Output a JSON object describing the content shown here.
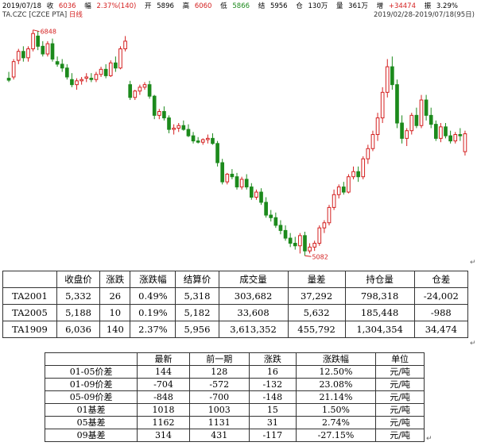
{
  "header": {
    "date": "2019/07/18",
    "close_label": "收",
    "close": "6036",
    "change_label": "幅",
    "change": "2.37%(140)",
    "open_label": "开",
    "open": "5896",
    "high_label": "高",
    "high": "6060",
    "low_label": "低",
    "low": "5866",
    "settle_label": "结",
    "settle": "5956",
    "oi_label": "仓",
    "oi": "130万",
    "vol_label": "量",
    "vol": "361万",
    "oi_chg_label": "增",
    "oi_chg": "+34474",
    "amp_label": "振",
    "amp": "3.29%",
    "symbol": "TA.CZC [CZCE PTA]",
    "mode": "日线",
    "range": "2019/02/28-2019/07/18(95日)"
  },
  "colors": {
    "up": "#d42020",
    "down": "#1c8a1c",
    "marker": "#d42020"
  },
  "chart_data": {
    "type": "candlestick",
    "title": "",
    "annotations": [
      {
        "text": "6848",
        "at": "high"
      },
      {
        "text": "5082",
        "at": "low"
      }
    ],
    "candles": [
      {
        "o": 6470,
        "h": 6520,
        "l": 6440,
        "c": 6455
      },
      {
        "o": 6480,
        "h": 6620,
        "l": 6460,
        "c": 6600
      },
      {
        "o": 6610,
        "h": 6700,
        "l": 6580,
        "c": 6680
      },
      {
        "o": 6680,
        "h": 6720,
        "l": 6600,
        "c": 6630
      },
      {
        "o": 6630,
        "h": 6720,
        "l": 6600,
        "c": 6700
      },
      {
        "o": 6700,
        "h": 6848,
        "l": 6680,
        "c": 6820
      },
      {
        "o": 6800,
        "h": 6840,
        "l": 6690,
        "c": 6720
      },
      {
        "o": 6720,
        "h": 6760,
        "l": 6640,
        "c": 6660
      },
      {
        "o": 6660,
        "h": 6760,
        "l": 6640,
        "c": 6740
      },
      {
        "o": 6740,
        "h": 6780,
        "l": 6600,
        "c": 6620
      },
      {
        "o": 6600,
        "h": 6640,
        "l": 6560,
        "c": 6580
      },
      {
        "o": 6580,
        "h": 6620,
        "l": 6520,
        "c": 6550
      },
      {
        "o": 6550,
        "h": 6580,
        "l": 6460,
        "c": 6480
      },
      {
        "o": 6460,
        "h": 6510,
        "l": 6400,
        "c": 6420
      },
      {
        "o": 6420,
        "h": 6470,
        "l": 6380,
        "c": 6450
      },
      {
        "o": 6450,
        "h": 6480,
        "l": 6420,
        "c": 6460
      },
      {
        "o": 6470,
        "h": 6510,
        "l": 6440,
        "c": 6480
      },
      {
        "o": 6470,
        "h": 6510,
        "l": 6440,
        "c": 6460
      },
      {
        "o": 6460,
        "h": 6520,
        "l": 6440,
        "c": 6500
      },
      {
        "o": 6500,
        "h": 6560,
        "l": 6480,
        "c": 6540
      },
      {
        "o": 6540,
        "h": 6580,
        "l": 6470,
        "c": 6490
      },
      {
        "o": 6490,
        "h": 6610,
        "l": 6480,
        "c": 6590
      },
      {
        "o": 6590,
        "h": 6640,
        "l": 6520,
        "c": 6550
      },
      {
        "o": 6550,
        "h": 6720,
        "l": 6540,
        "c": 6700
      },
      {
        "o": 6700,
        "h": 6800,
        "l": 6680,
        "c": 6760
      },
      {
        "o": 6420,
        "h": 6450,
        "l": 6300,
        "c": 6320
      },
      {
        "o": 6320,
        "h": 6380,
        "l": 6300,
        "c": 6370
      },
      {
        "o": 6370,
        "h": 6420,
        "l": 6340,
        "c": 6400
      },
      {
        "o": 6400,
        "h": 6440,
        "l": 6380,
        "c": 6420
      },
      {
        "o": 6420,
        "h": 6450,
        "l": 6310,
        "c": 6330
      },
      {
        "o": 6330,
        "h": 6340,
        "l": 6150,
        "c": 6180
      },
      {
        "o": 6180,
        "h": 6230,
        "l": 6150,
        "c": 6210
      },
      {
        "o": 6210,
        "h": 6250,
        "l": 6140,
        "c": 6160
      },
      {
        "o": 6160,
        "h": 6180,
        "l": 6040,
        "c": 6070
      },
      {
        "o": 6070,
        "h": 6110,
        "l": 6030,
        "c": 6080
      },
      {
        "o": 6080,
        "h": 6120,
        "l": 6050,
        "c": 6100
      },
      {
        "o": 6100,
        "h": 6140,
        "l": 6060,
        "c": 6070
      },
      {
        "o": 6070,
        "h": 6110,
        "l": 6010,
        "c": 6020
      },
      {
        "o": 6020,
        "h": 6050,
        "l": 5960,
        "c": 5980
      },
      {
        "o": 5980,
        "h": 6010,
        "l": 5960,
        "c": 5970
      },
      {
        "o": 5970,
        "h": 6000,
        "l": 5950,
        "c": 5990
      },
      {
        "o": 5990,
        "h": 6030,
        "l": 5960,
        "c": 6000
      },
      {
        "o": 6000,
        "h": 6040,
        "l": 5950,
        "c": 5960
      },
      {
        "o": 5960,
        "h": 5980,
        "l": 5780,
        "c": 5810
      },
      {
        "o": 5810,
        "h": 5840,
        "l": 5640,
        "c": 5660
      },
      {
        "o": 5660,
        "h": 5730,
        "l": 5640,
        "c": 5720
      },
      {
        "o": 5720,
        "h": 5760,
        "l": 5680,
        "c": 5700
      },
      {
        "o": 5700,
        "h": 5730,
        "l": 5600,
        "c": 5620
      },
      {
        "o": 5620,
        "h": 5700,
        "l": 5600,
        "c": 5680
      },
      {
        "o": 5680,
        "h": 5720,
        "l": 5600,
        "c": 5620
      },
      {
        "o": 5620,
        "h": 5650,
        "l": 5520,
        "c": 5540
      },
      {
        "o": 5540,
        "h": 5600,
        "l": 5520,
        "c": 5580
      },
      {
        "o": 5580,
        "h": 5610,
        "l": 5480,
        "c": 5500
      },
      {
        "o": 5500,
        "h": 5540,
        "l": 5380,
        "c": 5400
      },
      {
        "o": 5400,
        "h": 5440,
        "l": 5350,
        "c": 5380
      },
      {
        "o": 5380,
        "h": 5420,
        "l": 5300,
        "c": 5320
      },
      {
        "o": 5320,
        "h": 5360,
        "l": 5250,
        "c": 5280
      },
      {
        "o": 5280,
        "h": 5320,
        "l": 5200,
        "c": 5220
      },
      {
        "o": 5220,
        "h": 5260,
        "l": 5150,
        "c": 5180
      },
      {
        "o": 5180,
        "h": 5230,
        "l": 5130,
        "c": 5160
      },
      {
        "o": 5160,
        "h": 5260,
        "l": 5100,
        "c": 5240
      },
      {
        "o": 5240,
        "h": 5270,
        "l": 5082,
        "c": 5120
      },
      {
        "o": 5120,
        "h": 5180,
        "l": 5100,
        "c": 5150
      },
      {
        "o": 5150,
        "h": 5200,
        "l": 5120,
        "c": 5180
      },
      {
        "o": 5180,
        "h": 5320,
        "l": 5160,
        "c": 5300
      },
      {
        "o": 5300,
        "h": 5360,
        "l": 5260,
        "c": 5340
      },
      {
        "o": 5340,
        "h": 5480,
        "l": 5320,
        "c": 5460
      },
      {
        "o": 5460,
        "h": 5600,
        "l": 5440,
        "c": 5560
      },
      {
        "o": 5560,
        "h": 5640,
        "l": 5530,
        "c": 5620
      },
      {
        "o": 5620,
        "h": 5660,
        "l": 5560,
        "c": 5580
      },
      {
        "o": 5580,
        "h": 5720,
        "l": 5570,
        "c": 5700
      },
      {
        "o": 5700,
        "h": 5780,
        "l": 5680,
        "c": 5740
      },
      {
        "o": 5740,
        "h": 5780,
        "l": 5660,
        "c": 5700
      },
      {
        "o": 5700,
        "h": 5860,
        "l": 5680,
        "c": 5840
      },
      {
        "o": 5840,
        "h": 5950,
        "l": 5800,
        "c": 5920
      },
      {
        "o": 5920,
        "h": 6060,
        "l": 5900,
        "c": 6030
      },
      {
        "o": 6030,
        "h": 6200,
        "l": 5980,
        "c": 6160
      },
      {
        "o": 6160,
        "h": 6400,
        "l": 6120,
        "c": 6360
      },
      {
        "o": 6360,
        "h": 6620,
        "l": 6320,
        "c": 6560
      },
      {
        "o": 6560,
        "h": 6640,
        "l": 6380,
        "c": 6420
      },
      {
        "o": 6420,
        "h": 6460,
        "l": 6080,
        "c": 6120
      },
      {
        "o": 6120,
        "h": 6180,
        "l": 5960,
        "c": 6000
      },
      {
        "o": 6000,
        "h": 6080,
        "l": 5940,
        "c": 6060
      },
      {
        "o": 6060,
        "h": 6200,
        "l": 6030,
        "c": 6180
      },
      {
        "o": 6180,
        "h": 6240,
        "l": 6080,
        "c": 6100
      },
      {
        "o": 6100,
        "h": 6340,
        "l": 6080,
        "c": 6300
      },
      {
        "o": 6300,
        "h": 6340,
        "l": 6140,
        "c": 6180
      },
      {
        "o": 6180,
        "h": 6240,
        "l": 6080,
        "c": 6110
      },
      {
        "o": 6110,
        "h": 6140,
        "l": 5980,
        "c": 6000
      },
      {
        "o": 6000,
        "h": 6120,
        "l": 5970,
        "c": 6090
      },
      {
        "o": 6090,
        "h": 6120,
        "l": 6000,
        "c": 6020
      },
      {
        "o": 6020,
        "h": 6060,
        "l": 5960,
        "c": 5980
      },
      {
        "o": 5980,
        "h": 6050,
        "l": 5960,
        "c": 6030
      },
      {
        "o": 6030,
        "h": 6080,
        "l": 5980,
        "c": 6020
      },
      {
        "o": 5896,
        "h": 6060,
        "l": 5866,
        "c": 6036
      }
    ]
  },
  "table1": {
    "headers": [
      "",
      "收盘价",
      "涨跌",
      "涨跌幅",
      "结算价",
      "成交量",
      "量差",
      "持仓量",
      "仓差"
    ],
    "rows": [
      [
        "TA2001",
        "5,332",
        "26",
        "0.49%",
        "5,318",
        "303,682",
        "37,292",
        "798,318",
        "-24,002"
      ],
      [
        "TA2005",
        "5,188",
        "10",
        "0.19%",
        "5,182",
        "33,608",
        "5,632",
        "185,448",
        "-988"
      ],
      [
        "TA1909",
        "6,036",
        "140",
        "2.37%",
        "5,956",
        "3,613,352",
        "455,792",
        "1,304,354",
        "34,474"
      ]
    ]
  },
  "table2": {
    "headers": [
      "",
      "最新",
      "前一期",
      "涨跌",
      "涨跌幅",
      "单位"
    ],
    "rows": [
      [
        "01-05价差",
        "144",
        "128",
        "16",
        "12.50%",
        "元/吨"
      ],
      [
        "01-09价差",
        "-704",
        "-572",
        "-132",
        "23.08%",
        "元/吨"
      ],
      [
        "05-09价差",
        "-848",
        "-700",
        "-148",
        "21.14%",
        "元/吨"
      ],
      [
        "01基差",
        "1018",
        "1003",
        "15",
        "1.50%",
        "元/吨"
      ],
      [
        "05基差",
        "1162",
        "1131",
        "31",
        "2.74%",
        "元/吨"
      ],
      [
        "09基差",
        "314",
        "431",
        "-117",
        "-27.15%",
        "元/吨"
      ]
    ]
  }
}
